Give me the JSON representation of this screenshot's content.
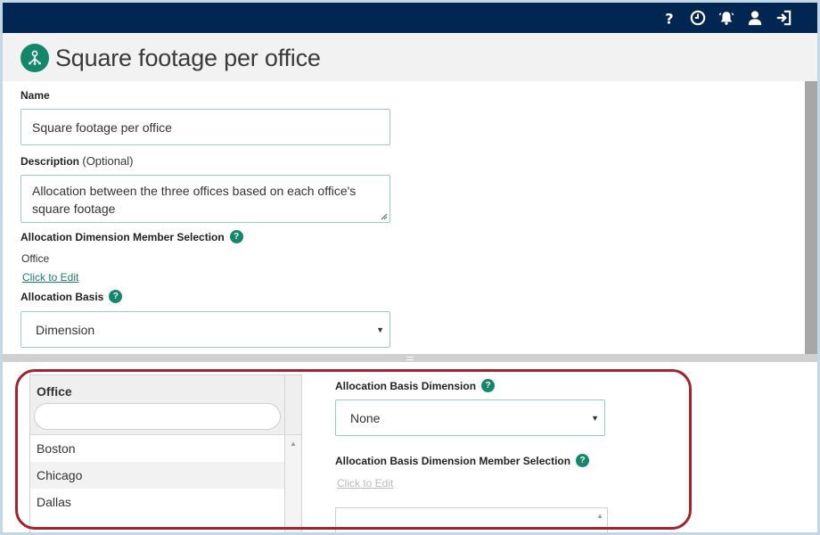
{
  "topbar": {
    "icons": [
      "help-icon",
      "history-clock-icon",
      "notifications-bell-icon",
      "user-icon",
      "sign-out-icon"
    ],
    "bg_color": "#022652"
  },
  "header": {
    "title": "Square footage per office",
    "logo_icon": "allocation-network-icon",
    "accent_color": "#12876a"
  },
  "form": {
    "name_label": "Name",
    "name_value": "Square footage per office",
    "description_label": "Description",
    "description_optional": "(Optional)",
    "description_value": "Allocation between the three offices based on each office's square footage",
    "dim_member_label": "Allocation Dimension Member Selection",
    "dim_member_value": "Office",
    "click_to_edit": "Click to Edit",
    "basis_label": "Allocation Basis",
    "basis_value": "Dimension",
    "help_glyph": "?"
  },
  "office_grid": {
    "header": "Office",
    "filter_value": "",
    "rows": [
      "Boston",
      "Chicago",
      "Dallas"
    ]
  },
  "right_panel": {
    "basis_dim_label": "Allocation Basis Dimension",
    "basis_dim_value": "None",
    "basis_member_label": "Allocation Basis Dimension Member Selection",
    "click_to_edit": "Click to Edit"
  },
  "highlight_color": "#a4232c"
}
